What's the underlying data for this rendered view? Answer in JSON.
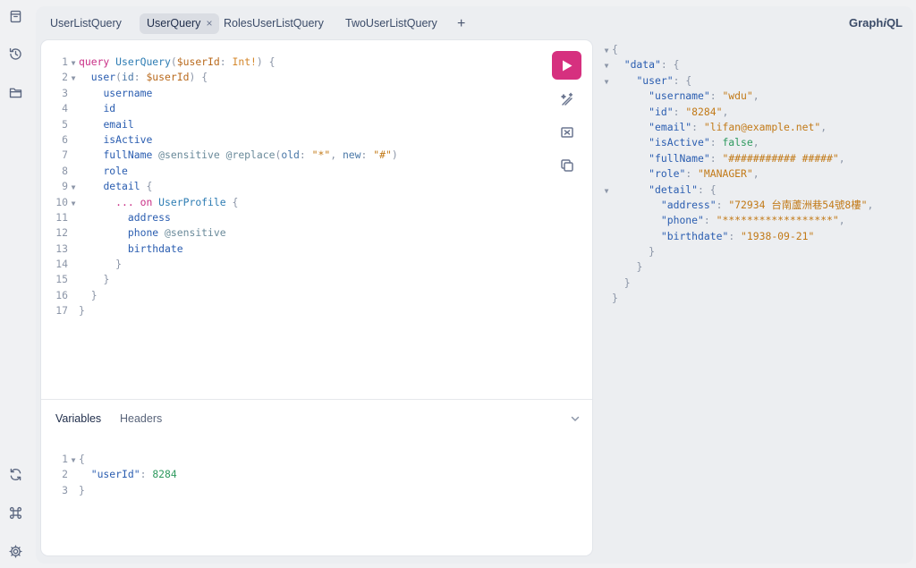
{
  "app": {
    "logo_main": "Graph",
    "logo_italic": "i",
    "logo_tail": "QL"
  },
  "rail": {
    "top": [
      {
        "name": "docs-icon"
      },
      {
        "name": "history-icon"
      },
      {
        "name": "explorer-folder-icon"
      }
    ],
    "bottom": [
      {
        "name": "refetch-schema-icon"
      },
      {
        "name": "shortcuts-command-icon"
      },
      {
        "name": "settings-gear-icon"
      }
    ]
  },
  "tabs": [
    {
      "label": "UserListQuery",
      "active": false
    },
    {
      "label": "UserQuery",
      "active": true,
      "close": "×"
    },
    {
      "label": "RolesUserListQuery",
      "active": false
    },
    {
      "label": "TwoUserListQuery",
      "active": false
    }
  ],
  "add_tab": "+",
  "editor": {
    "line_numbers": [
      "1",
      "2",
      "3",
      "4",
      "5",
      "6",
      "7",
      "8",
      "9",
      "10",
      "11",
      "12",
      "13",
      "14",
      "15",
      "16",
      "17"
    ],
    "lines": {
      "l1": {
        "kw": "query",
        "name": "UserQuery",
        "open": "(",
        "var": "$userId",
        "colon": ":",
        "type": "Int!",
        "close": ")",
        "brace": "{"
      },
      "l2": {
        "field": "user",
        "open": "(",
        "arg": "id",
        "colon": ":",
        "var": "$userId",
        "close": ")",
        "brace": "{"
      },
      "l3": "username",
      "l4": "id",
      "l5": "email",
      "l6": "isActive",
      "l7": {
        "field": "fullName",
        "dir1": "@sensitive",
        "dir2": "@replace",
        "open": "(",
        "arg1": "old",
        "val1": "\"*\"",
        "arg2": "new",
        "val2": "\"#\"",
        "close": ")"
      },
      "l8": "role",
      "l9": {
        "field": "detail",
        "brace": "{"
      },
      "l10": {
        "spread": "...",
        "on": "on",
        "type": "UserProfile",
        "brace": "{"
      },
      "l11": "address",
      "l12": {
        "field": "phone",
        "dir": "@sensitive"
      },
      "l13": "birthdate",
      "close_brace": "}"
    }
  },
  "variables_panel": {
    "tabs": [
      "Variables",
      "Headers"
    ],
    "line_numbers": [
      "1",
      "2",
      "3"
    ],
    "open": "{",
    "key": "\"userId\"",
    "colon": ":",
    "value": "8284",
    "close": "}"
  },
  "result": {
    "open": "{",
    "close": "}",
    "data_key": "\"data\"",
    "user_key": "\"user\"",
    "fields": [
      {
        "key": "\"username\"",
        "value": "\"wdu\"",
        "comma": ","
      },
      {
        "key": "\"id\"",
        "value": "\"8284\"",
        "comma": ","
      },
      {
        "key": "\"email\"",
        "value": "\"lifan@example.net\"",
        "comma": ","
      },
      {
        "key": "\"isActive\"",
        "value": "false",
        "comma": ","
      },
      {
        "key": "\"fullName\"",
        "value": "\"########### #####\"",
        "comma": ","
      },
      {
        "key": "\"role\"",
        "value": "\"MANAGER\"",
        "comma": ","
      }
    ],
    "detail_key": "\"detail\"",
    "detail_fields": [
      {
        "key": "\"address\"",
        "value": "\"72934 台南蘆洲巷54號8樓\"",
        "comma": ","
      },
      {
        "key": "\"phone\"",
        "value": "\"******************\"",
        "comma": ","
      },
      {
        "key": "\"birthdate\"",
        "value": "\"1938-09-21\"",
        "comma": ""
      }
    ]
  },
  "colors": {
    "run_button": "#d6307f",
    "string": "#c27a18",
    "keyword": "#c92f86",
    "field": "#2a5db0"
  }
}
